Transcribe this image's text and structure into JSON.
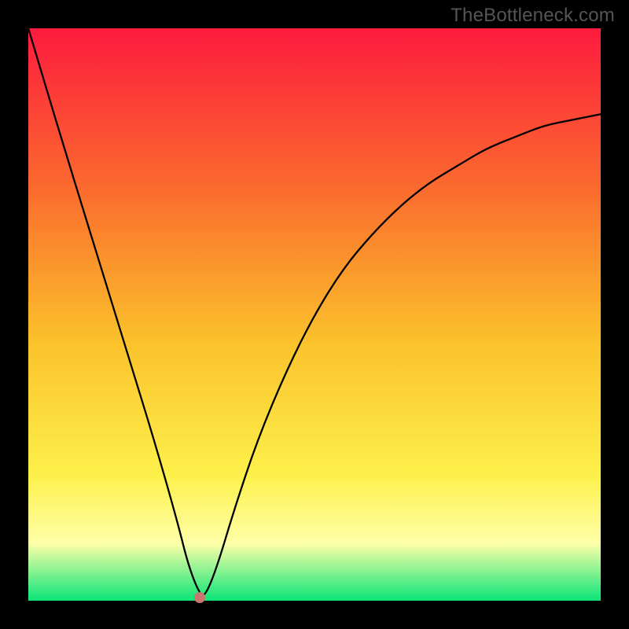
{
  "watermark": "TheBottleneck.com",
  "colors": {
    "frame_bg": "#000000",
    "gradient": {
      "top": "#fd1b3e",
      "upper": "#fb6b2e",
      "mid": "#fbc22b",
      "low": "#fdf04a",
      "pale": "#feffa8",
      "green": "#15e67a"
    },
    "curve": "#000000",
    "dot": "#c9766e"
  },
  "chart_data": {
    "type": "line",
    "title": "",
    "xlabel": "",
    "ylabel": "",
    "xlim": [
      0,
      100
    ],
    "ylim": [
      0,
      100
    ],
    "notes": "V-shaped bottleneck curve; minimum (~0) near x≈30; left arm reaches y=100 at x=0; right arm rises from minimum and asymptotes toward ~y≈85 at x=100. Gradient background encodes y (red=100 → green=0).",
    "series": [
      {
        "name": "bottleneck-curve",
        "x": [
          0,
          3,
          6,
          10,
          14,
          18,
          22,
          26,
          28,
          30,
          31,
          33,
          36,
          40,
          45,
          50,
          55,
          60,
          65,
          70,
          75,
          80,
          85,
          90,
          95,
          100
        ],
        "values": [
          100,
          90,
          80,
          67,
          54,
          41,
          28,
          14,
          6,
          1,
          1,
          6,
          16,
          28,
          40,
          50,
          58,
          64,
          69,
          73,
          76,
          79,
          81,
          83,
          84,
          85
        ]
      }
    ],
    "marker": {
      "x": 30,
      "y": 0.5,
      "name": "optimal-point"
    }
  }
}
